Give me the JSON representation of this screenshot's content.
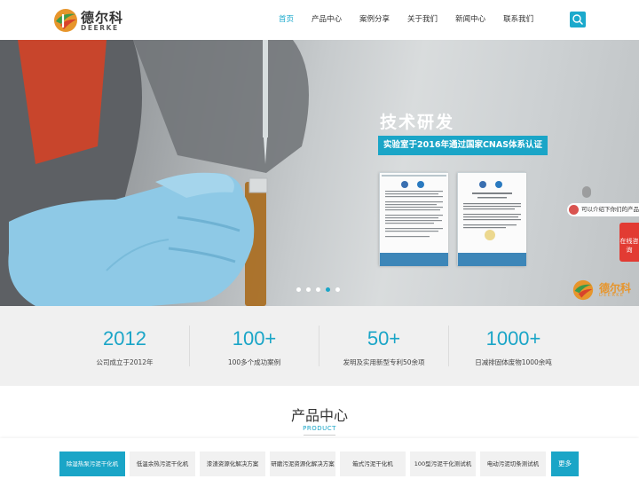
{
  "header": {
    "logo_cn": "德尔科",
    "logo_en": "DEERKE",
    "nav": [
      "首页",
      "产品中心",
      "案例分享",
      "关于我们",
      "新闻中心",
      "联系我们"
    ],
    "search_icon": "search-icon"
  },
  "banner": {
    "title": "技术研发",
    "subtitle": "实验室于2016年通过国家CNAS体系认证",
    "slide_count": 4,
    "active_slide": 3,
    "chat_prompt_1": "",
    "chat_prompt_2": "可以介绍下你们的产品么",
    "online_label": "在线咨询",
    "watermark_cn": "德尔科",
    "watermark_en": "DEERKE",
    "cert_icons": [
      "ilac-mra-logo",
      "cnas-logo"
    ]
  },
  "stats": [
    {
      "num": "2012",
      "label": "公司成立于2012年"
    },
    {
      "num": "100+",
      "label": "100多个成功案例"
    },
    {
      "num": "50+",
      "label": "发明及实用新型专利50余项"
    },
    {
      "num": "1000+",
      "label": "日减排固体废物1000余吨"
    }
  ],
  "products": {
    "title": "产品中心",
    "title_en": "PRODUCT",
    "tabs": [
      "除湿热泵污泥干化机",
      "低温余热污泥干化机",
      "漆渣资源化解决方案",
      "研磨污泥资源化解决方案",
      "箱式污泥干化机",
      "100型污泥干化测试机",
      "电动污泥切条测试机"
    ],
    "more_label": "更多"
  },
  "colors": {
    "accent": "#1aa5c7",
    "stat_bg": "#f0f0f0",
    "online_red": "#e23b33",
    "logo_orange": "#e7952b",
    "logo_green": "#3f9a48"
  }
}
